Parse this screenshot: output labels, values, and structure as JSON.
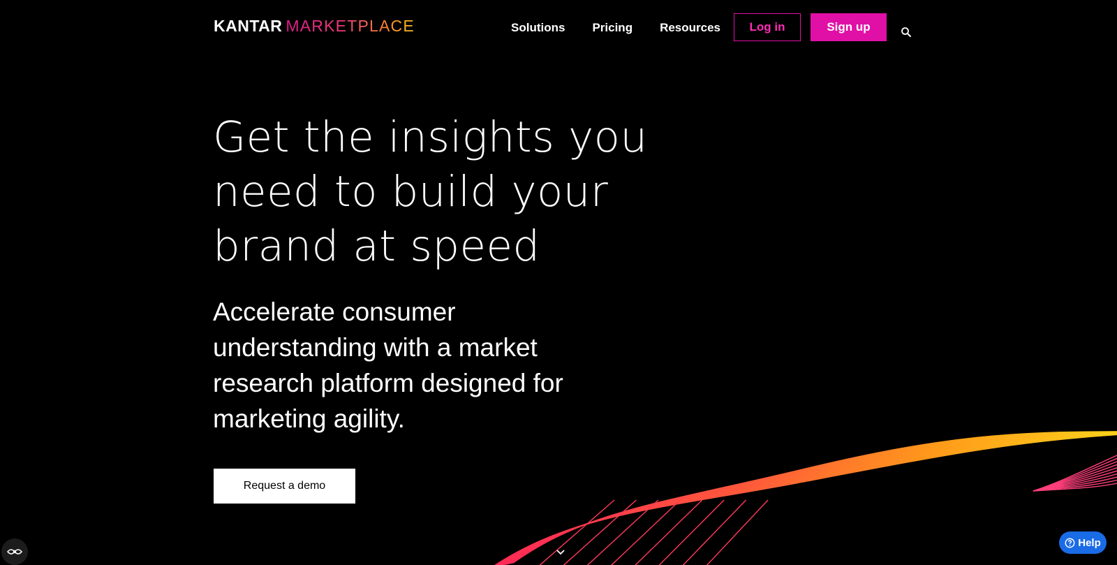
{
  "header": {
    "logo_primary": "KANTAR",
    "logo_secondary": "MARKETPLACE",
    "nav": [
      {
        "label": "Solutions"
      },
      {
        "label": "Pricing"
      },
      {
        "label": "Resources"
      }
    ],
    "login_label": "Log in",
    "signup_label": "Sign up",
    "search_icon": "search-icon"
  },
  "hero": {
    "title": "Get the insights you need to build your brand at speed",
    "subtitle": "Accelerate consumer understanding with a market research platform designed for marketing agility.",
    "cta_label": "Request a demo",
    "scroll_icon": "chevron-down-icon"
  },
  "widgets": {
    "accessibility_icon": "accessibility-icon",
    "help_label": "Help",
    "help_icon": "question-circle-icon"
  },
  "colors": {
    "background": "#000000",
    "accent": "#e010a6",
    "help_blue": "#1a6be6",
    "wave_start": "#ff2060",
    "wave_end": "#ffd21a"
  }
}
